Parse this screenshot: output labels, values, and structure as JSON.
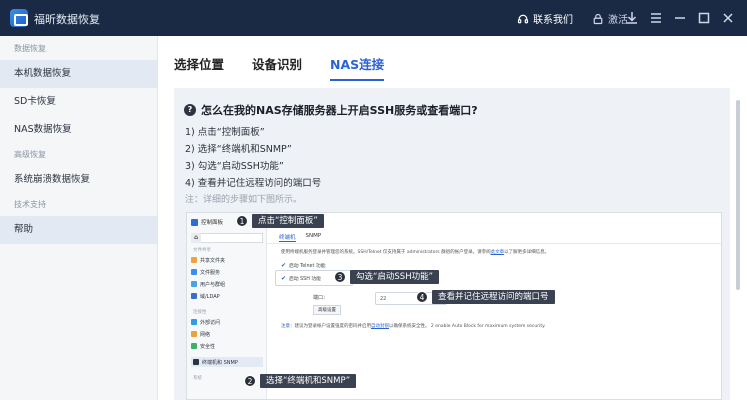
{
  "titlebar": {
    "app_title": "福昕数据恢复",
    "contact_label": "联系我们",
    "activate_label": "激活",
    "icons": [
      "headset-icon",
      "lock-icon",
      "download-icon",
      "menu-icon",
      "minimize-icon",
      "maximize-icon",
      "close-icon"
    ]
  },
  "sidebar": {
    "group_recovery": "数据恢复",
    "item_local": "本机数据恢复",
    "item_sd": "SD卡恢复",
    "item_nas": "NAS数据恢复",
    "group_advanced": "高级恢复",
    "item_crash": "系统崩溃数据恢复",
    "group_support": "技术支持",
    "item_help": "帮助"
  },
  "tabs": {
    "location": "选择位置",
    "device": "设备识别",
    "nas": "NAS连接"
  },
  "help": {
    "question": "怎么在我的NAS存储服务器上开启SSH服务或查看端口?",
    "steps": [
      "1) 点击“控制面板”",
      "2) 选择“终端机和SNMP”",
      "3) 勾选“启动SSH功能”",
      "4) 查看并记住远程访问的端口号"
    ],
    "note": "注：详细的步骤如下图所示。"
  },
  "screenshot": {
    "header": "控制面板",
    "group1": "文件共享",
    "items1": [
      "共享文件夹",
      "文件服务",
      "用户与群组",
      "域/LDAP"
    ],
    "group2": "连接性",
    "items2": [
      "外部访问",
      "网络",
      "安全性",
      "终端机和 SNMP"
    ],
    "group3": "系统",
    "tab_terminal": "终端机",
    "tab_snmp": "SNMP",
    "desc_text": "使用终端机服务登录并管理您的系统。SSH/Telnet 仅支持属于 administrators 群组的帐户登录。请参阅",
    "desc_link": "此文章",
    "desc_tail": "以了解更多详细信息。",
    "telnet_label": "启动 Telnet 功能",
    "ssh_label": "启动 SSH 功能",
    "port_label": "端口：",
    "port_value": "22",
    "adv_label": "高级设置",
    "tip_label": "注意：",
    "tip_text": "建议为登录帐户设置强度的密码并启用",
    "tip_link": "自动封锁",
    "tip_tail": "以确保系统安全性。 2 enable Auto Block for maximum system security.",
    "tip_link2": "Auto Block"
  },
  "callouts": [
    {
      "num": "1",
      "text": "点击“控制面板”"
    },
    {
      "num": "2",
      "text": "选择“终端机和SNMP”"
    },
    {
      "num": "3",
      "text": "勾选“启动SSH功能”"
    },
    {
      "num": "4",
      "text": "查看并记住远程访问的端口号"
    }
  ]
}
